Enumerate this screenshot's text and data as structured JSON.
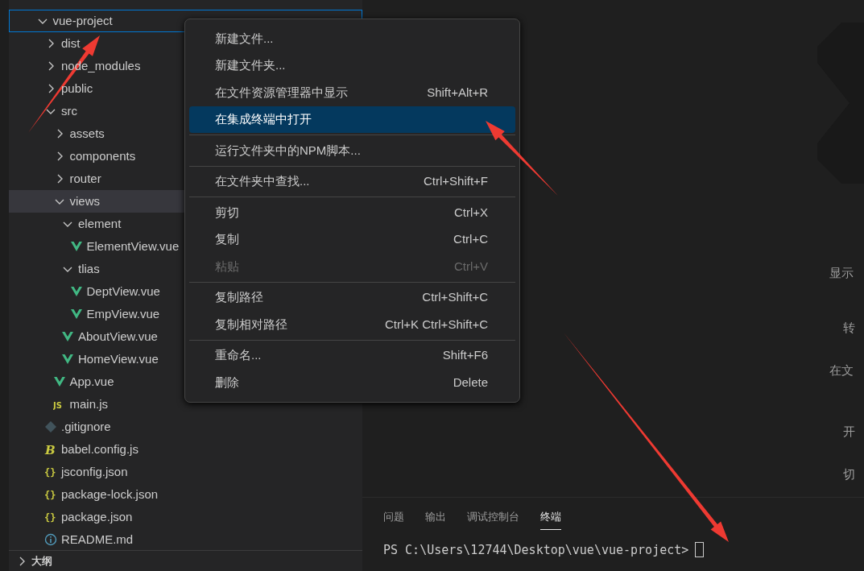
{
  "explorer": {
    "tree": [
      {
        "label": "vue-project",
        "kind": "folder",
        "expanded": true,
        "focused": true,
        "selected": false,
        "children": [
          {
            "label": "dist",
            "kind": "folder",
            "expanded": false,
            "focused": false,
            "selected": false
          },
          {
            "label": "node_modules",
            "kind": "folder",
            "expanded": false,
            "focused": false,
            "selected": false
          },
          {
            "label": "public",
            "kind": "folder",
            "expanded": false,
            "focused": false,
            "selected": false
          },
          {
            "label": "src",
            "kind": "folder",
            "expanded": true,
            "focused": false,
            "selected": false,
            "children": [
              {
                "label": "assets",
                "kind": "folder",
                "expanded": false,
                "focused": false,
                "selected": false
              },
              {
                "label": "components",
                "kind": "folder",
                "expanded": false,
                "focused": false,
                "selected": false
              },
              {
                "label": "router",
                "kind": "folder",
                "expanded": false,
                "focused": false,
                "selected": false
              },
              {
                "label": "views",
                "kind": "folder",
                "expanded": true,
                "focused": false,
                "selected": true,
                "children": [
                  {
                    "label": "element",
                    "kind": "folder",
                    "expanded": true,
                    "focused": false,
                    "selected": false,
                    "children": [
                      {
                        "label": "ElementView.vue",
                        "kind": "vue",
                        "focused": false,
                        "selected": false
                      }
                    ]
                  },
                  {
                    "label": "tlias",
                    "kind": "folder",
                    "expanded": true,
                    "focused": false,
                    "selected": false,
                    "children": [
                      {
                        "label": "DeptView.vue",
                        "kind": "vue",
                        "focused": false,
                        "selected": false
                      },
                      {
                        "label": "EmpView.vue",
                        "kind": "vue",
                        "focused": false,
                        "selected": false
                      }
                    ]
                  },
                  {
                    "label": "AboutView.vue",
                    "kind": "vue",
                    "focused": false,
                    "selected": false
                  },
                  {
                    "label": "HomeView.vue",
                    "kind": "vue",
                    "focused": false,
                    "selected": false
                  }
                ]
              },
              {
                "label": "App.vue",
                "kind": "vue",
                "focused": false,
                "selected": false
              },
              {
                "label": "main.js",
                "kind": "js",
                "icon_text": "JS",
                "focused": false,
                "selected": false
              }
            ]
          },
          {
            "label": ".gitignore",
            "kind": "git",
            "focused": false,
            "selected": false
          },
          {
            "label": "babel.config.js",
            "kind": "babel",
            "icon_text": "B",
            "focused": false,
            "selected": false
          },
          {
            "label": "jsconfig.json",
            "kind": "json",
            "icon_text": "{}",
            "focused": false,
            "selected": false
          },
          {
            "label": "package-lock.json",
            "kind": "json",
            "icon_text": "{}",
            "focused": false,
            "selected": false
          },
          {
            "label": "package.json",
            "kind": "json",
            "icon_text": "{}",
            "focused": false,
            "selected": false
          },
          {
            "label": "README.md",
            "kind": "info",
            "focused": false,
            "selected": false
          }
        ]
      }
    ],
    "outline": {
      "label": "大纲",
      "expanded": false
    }
  },
  "context_menu": {
    "groups": [
      [
        {
          "label": "新建文件...",
          "selected": false,
          "disabled": false
        },
        {
          "label": "新建文件夹...",
          "selected": false,
          "disabled": false
        },
        {
          "label": "在文件资源管理器中显示",
          "shortcut": "Shift+Alt+R",
          "selected": false,
          "disabled": false
        },
        {
          "label": "在集成终端中打开",
          "selected": true,
          "disabled": false
        }
      ],
      [
        {
          "label": "运行文件夹中的NPM脚本...",
          "selected": false,
          "disabled": false
        }
      ],
      [
        {
          "label": "在文件夹中查找...",
          "shortcut": "Ctrl+Shift+F",
          "selected": false,
          "disabled": false
        }
      ],
      [
        {
          "label": "剪切",
          "shortcut": "Ctrl+X",
          "selected": false,
          "disabled": false
        },
        {
          "label": "复制",
          "shortcut": "Ctrl+C",
          "selected": false,
          "disabled": false
        },
        {
          "label": "粘贴",
          "shortcut": "Ctrl+V",
          "selected": false,
          "disabled": true
        }
      ],
      [
        {
          "label": "复制路径",
          "shortcut": "Ctrl+Shift+C",
          "selected": false,
          "disabled": false
        },
        {
          "label": "复制相对路径",
          "shortcut": "Ctrl+K Ctrl+Shift+C",
          "selected": false,
          "disabled": false
        }
      ],
      [
        {
          "label": "重命名...",
          "shortcut": "Shift+F6",
          "selected": false,
          "disabled": false
        },
        {
          "label": "删除",
          "shortcut": "Delete",
          "selected": false,
          "disabled": false
        }
      ]
    ]
  },
  "editor": {
    "welcome_hints": [
      {
        "text": "显示",
        "indent": false
      },
      {
        "text": "转",
        "indent": true
      },
      {
        "text": "在文",
        "indent": false
      },
      {
        "text": "开",
        "indent": true
      },
      {
        "text": "切",
        "indent": true
      }
    ]
  },
  "panel": {
    "tabs": [
      {
        "label": "问题",
        "selected": false
      },
      {
        "label": "输出",
        "selected": false
      },
      {
        "label": "调试控制台",
        "selected": false
      },
      {
        "label": "终端",
        "selected": true
      }
    ],
    "terminal": {
      "prompt": "PS C:\\Users\\12744\\Desktop\\vue\\vue-project>"
    }
  }
}
